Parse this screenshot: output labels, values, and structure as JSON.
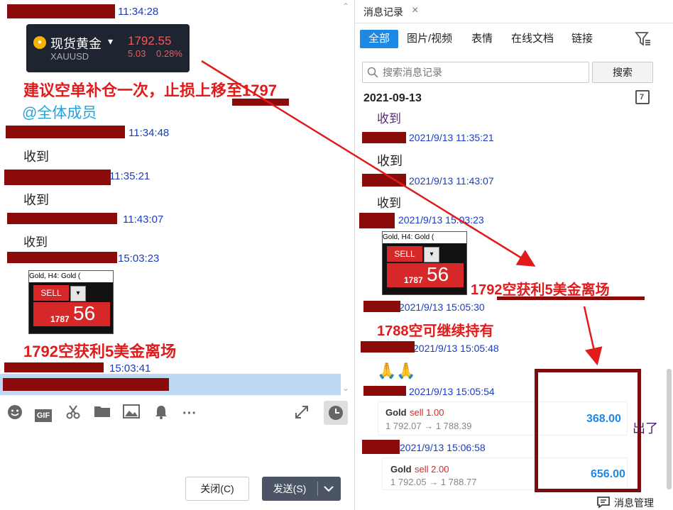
{
  "left": {
    "msg1_time": "11:34:28",
    "gold_card": {
      "name": "现货黄金",
      "arrow": "▾",
      "code": "XAUUSD",
      "price": "1792.55",
      "change": "5.03",
      "change_pct": "0.28%"
    },
    "advice": "建议空单补仓一次，止损上移至1797",
    "mention": "@全体成员",
    "msg2_time": "11:34:48",
    "msg2_text": "收到",
    "msg3_time": "11:35:21",
    "msg3_text": "收到",
    "msg4_time": "11:43:07",
    "msg4_text": "收到",
    "msg5_time": "15:03:23",
    "widget": {
      "header": "Gold, H4:  Gold (",
      "sell": "SELL",
      "dd": "▾",
      "price_prefix": "1787",
      "price_big": "56"
    },
    "exit_note": "1792空获利5美金离场",
    "msg6_time": "15:03:41"
  },
  "toolbar": {
    "gif": "GIF",
    "more": "···",
    "close_label": "关闭(C)",
    "send_label": "发送(S)"
  },
  "right": {
    "tab_title": "消息记录",
    "close_x": "×",
    "filters": [
      "全部",
      "图片/视频",
      "表情",
      "在线文档",
      "链接"
    ],
    "search_placeholder": "搜索消息记录",
    "search_button": "搜索",
    "date": "2021-09-13",
    "calendar_day": "7",
    "entries": [
      {
        "text": "收到"
      },
      {
        "time": "2021/9/13 11:35:21",
        "text": "收到"
      },
      {
        "time": "2021/9/13 11:43:07",
        "text": "收到"
      },
      {
        "time": "2021/9/13 15:03:23"
      },
      {
        "time": "2021/9/13 15:05:30"
      },
      {
        "time": "2021/9/13 15:05:48"
      },
      {
        "time": "2021/9/13 15:05:54"
      },
      {
        "time": "2021/9/13 15:06:58"
      }
    ],
    "note_1792": "1792空获利5美金离场",
    "note_1788": "1788空可继续持有",
    "emoji": "🙏🙏",
    "orders": [
      {
        "symbol": "Gold",
        "side": "sell 1.00",
        "prices": "1 792.07 → 1 788.39",
        "profit": "368.00"
      },
      {
        "symbol": "Gold",
        "side": "sell 2.00",
        "prices": "1 792.05 → 1 788.77",
        "profit": "656.00"
      }
    ],
    "out_label": "出了",
    "manage_label": "消息管理"
  },
  "colors": {
    "accent": "#1e88e5",
    "red": "#e11b1b",
    "redact": "#8b0a0a",
    "timestamp": "#1a3dbf"
  }
}
